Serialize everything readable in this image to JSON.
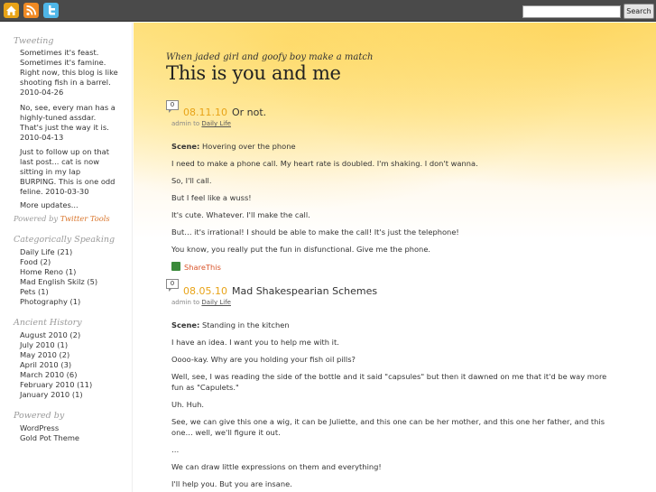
{
  "topbar": {
    "search_placeholder": "",
    "search_button": "Search"
  },
  "sidebar": {
    "tweeting": {
      "heading": "Tweeting",
      "tweets": [
        {
          "lines": [
            "Sometimes it's feast.",
            "Sometimes it's famine.",
            "Right now, this blog is like",
            "shooting fish in a barrel.",
            "2010-04-26"
          ]
        },
        {
          "lines": [
            "No, see, every man has a",
            "highly-tuned assdar.",
            "That's just the way it is.",
            "2010-04-13"
          ]
        },
        {
          "lines": [
            "Just to follow up on that",
            "last post... cat is now",
            "sitting in my lap",
            "BURPING. This is one odd",
            "feline. 2010-03-30"
          ]
        }
      ],
      "more": "More updates...",
      "powered_prefix": "Powered by",
      "powered_link": "Twitter Tools"
    },
    "categories": {
      "heading": "Categorically Speaking",
      "items": [
        "Daily Life (21)",
        "Food (2)",
        "Home Reno (1)",
        "Mad English Skilz (5)",
        "Pets (1)",
        "Photography (1)"
      ]
    },
    "archives": {
      "heading": "Ancient History",
      "items": [
        "August 2010 (2)",
        "July 2010 (1)",
        "May 2010 (2)",
        "April 2010 (3)",
        "March 2010 (6)",
        "February 2010 (11)",
        "January 2010 (1)"
      ]
    },
    "powered": {
      "heading": "Powered by",
      "items": [
        "WordPress",
        "Gold Pot Theme"
      ]
    }
  },
  "header": {
    "tagline": "When jaded girl and goofy boy make a match",
    "title": "This is you and me"
  },
  "posts": [
    {
      "comments": "0",
      "date": "08.11.10",
      "title": "Or not.",
      "author": "admin to",
      "category": "Daily Life",
      "scene_label": "Scene:",
      "scene_text": " Hovering over the phone",
      "paragraphs": [
        "I need to make a phone call. My heart rate is doubled. I'm shaking. I don't wanna.",
        "So, I'll call.",
        "But I feel like a wuss!",
        "It's cute. Whatever. I'll make the call.",
        "But… it's irrational! I should be able to make the call! It's just the telephone!",
        "You know, you really put the fun in disfunctional. Give me the phone."
      ],
      "share": "ShareThis"
    },
    {
      "comments": "0",
      "date": "08.05.10",
      "title": "Mad Shakespearian Schemes",
      "author": "admin to",
      "category": "Daily Life",
      "scene_label": "Scene:",
      "scene_text": " Standing in the kitchen",
      "paragraphs": [
        "I have an idea. I want you to help me with it.",
        "Oooo-kay. Why are you holding your fish oil pills?",
        "Well, see, I was reading the side of the bottle and it said \"capsules\" but then it dawned on me that it'd be way more",
        "fun as \"Capulets.\"",
        "Uh. Huh.",
        "See, we can give this one a wig, it can be Juliette, and this one can be her mother, and this one her father, and this",
        "one… well, we'll figure it out.",
        "…",
        "We can draw little expressions on them and everything!",
        "I'll help you. But you are insane."
      ]
    }
  ]
}
